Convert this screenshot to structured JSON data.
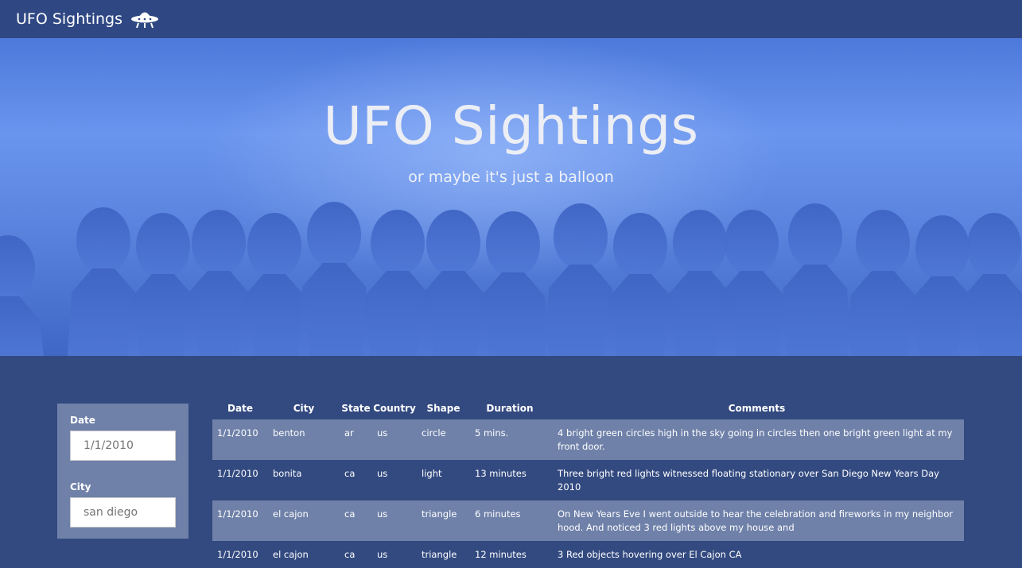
{
  "navbar": {
    "brand": "UFO Sightings",
    "icon": "ufo-icon"
  },
  "hero": {
    "title": "UFO Sightings",
    "subtitle": "or maybe it's just a balloon"
  },
  "filters": {
    "date_label": "Date",
    "date_value": "1/1/2010",
    "city_label": "City",
    "city_value": "san diego"
  },
  "table": {
    "headers": [
      "Date",
      "City",
      "State",
      "Country",
      "Shape",
      "Duration",
      "Comments"
    ],
    "rows": [
      [
        "1/1/2010",
        "benton",
        "ar",
        "us",
        "circle",
        "5 mins.",
        "4 bright green circles high in the sky going in circles then one bright green light at my front door."
      ],
      [
        "1/1/2010",
        "bonita",
        "ca",
        "us",
        "light",
        "13 minutes",
        "Three bright red lights witnessed floating stationary over San Diego New Years Day 2010"
      ],
      [
        "1/1/2010",
        "el cajon",
        "ca",
        "us",
        "triangle",
        "6 minutes",
        "On New Years Eve I went outside to hear the celebration and fireworks in my neighbor hood. And noticed 3 red lights above my house and"
      ],
      [
        "1/1/2010",
        "el cajon",
        "ca",
        "us",
        "triangle",
        "12 minutes",
        "3 Red objects hovering over El Cajon CA"
      ]
    ]
  },
  "colors": {
    "background": "#334a80",
    "navbar": "#2f4884",
    "panel": "#6f81a9"
  }
}
